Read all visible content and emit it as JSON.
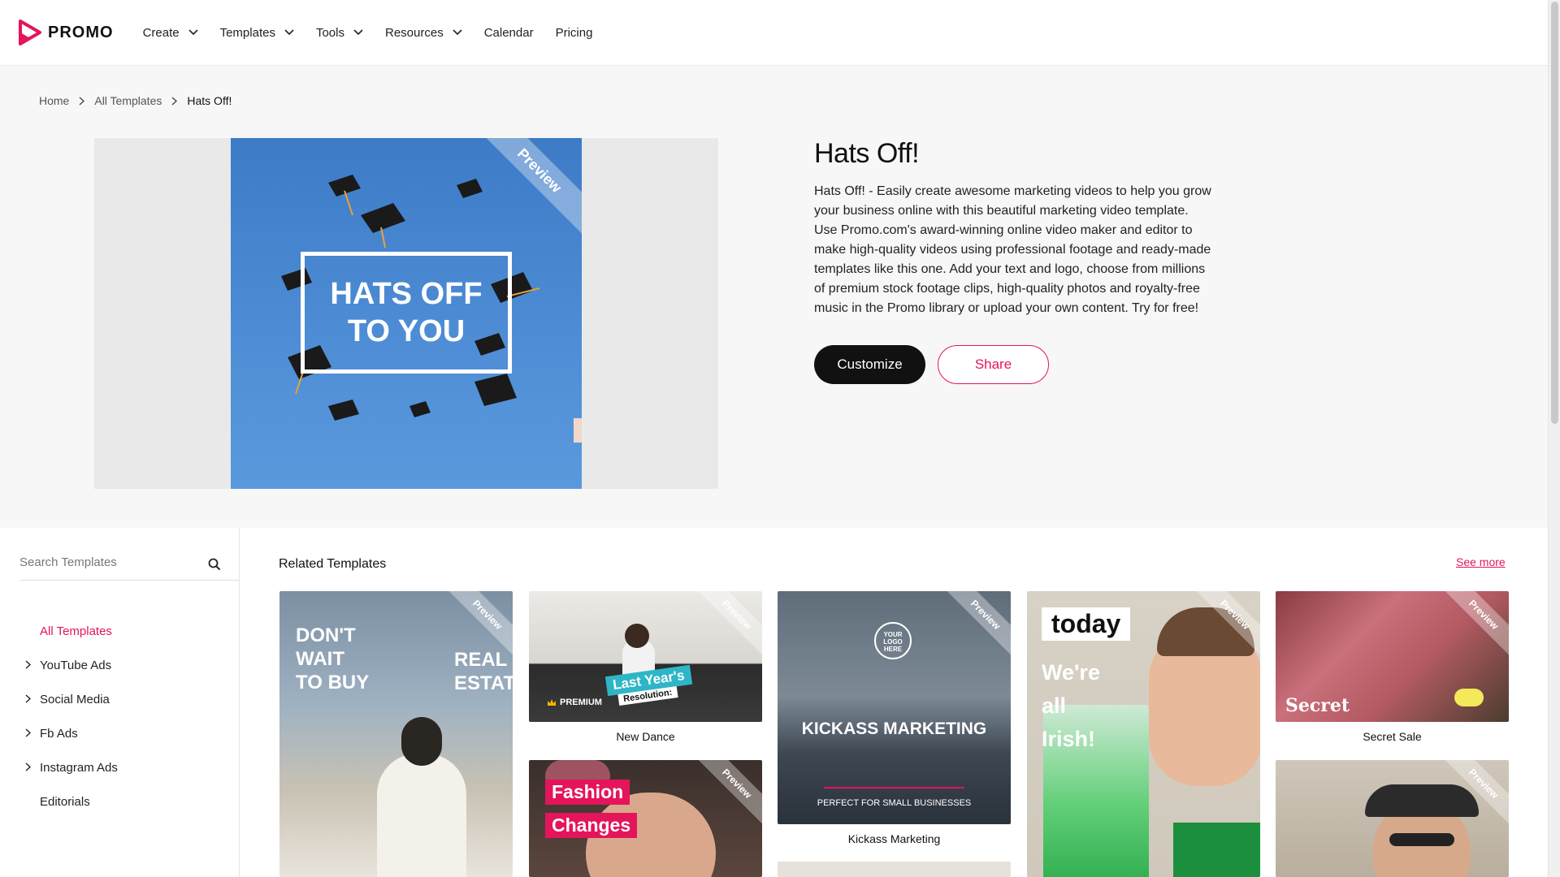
{
  "header": {
    "logo_text": "PROMO",
    "nav": [
      {
        "label": "Create",
        "has_dropdown": true
      },
      {
        "label": "Templates",
        "has_dropdown": true
      },
      {
        "label": "Tools",
        "has_dropdown": true
      },
      {
        "label": "Resources",
        "has_dropdown": true
      },
      {
        "label": "Calendar",
        "has_dropdown": false
      },
      {
        "label": "Pricing",
        "has_dropdown": false
      }
    ]
  },
  "breadcrumb": {
    "items": [
      "Home",
      "All Templates"
    ],
    "current": "Hats Off!"
  },
  "preview": {
    "ribbon": "Preview",
    "line1": "HATS OFF",
    "line2": "TO YOU"
  },
  "template": {
    "title": "Hats Off!",
    "description": "Hats Off! - Easily create awesome marketing videos to help you grow your business online with this beautiful marketing video template. Use Promo.com's award-winning online video maker and editor to make high-quality videos using professional footage and ready-made templates like this one. Add your text and logo, choose from millions of premium stock footage clips, high-quality photos and royalty-free music in the Promo library or upload your own content. Try for free!",
    "customize_label": "Customize",
    "share_label": "Share"
  },
  "sidebar": {
    "search_placeholder": "Search Templates",
    "categories": [
      {
        "label": "All Templates",
        "active": true,
        "expandable": false
      },
      {
        "label": "YouTube Ads",
        "active": false,
        "expandable": true
      },
      {
        "label": "Social Media",
        "active": false,
        "expandable": true
      },
      {
        "label": "Fb Ads",
        "active": false,
        "expandable": true
      },
      {
        "label": "Instagram Ads",
        "active": false,
        "expandable": true
      },
      {
        "label": "Editorials",
        "active": false,
        "expandable": false
      }
    ]
  },
  "related": {
    "title": "Related Templates",
    "see_more": "See more",
    "ribbon": "Preview",
    "premium_badge": "PREMIUM",
    "cards": [
      {
        "name": "",
        "overlay": [
          "DON'T",
          "WAIT",
          "TO BUY"
        ],
        "overlay2": [
          "REAL",
          "ESTATE"
        ]
      },
      {
        "name": "New Dance",
        "overlay": [
          "Last Year's",
          "Resolution:"
        ]
      },
      {
        "name": "Kickass Marketing",
        "overlay": [
          "KICKASS MARKETING"
        ],
        "sub": "PERFECT FOR SMALL BUSINESSES",
        "logo": [
          "YOUR",
          "LOGO",
          "HERE"
        ]
      },
      {
        "name": "",
        "overlay": [
          "today",
          "We're",
          "all",
          "Irish!"
        ]
      },
      {
        "name": "Secret Sale",
        "overlay": [
          "Secret"
        ]
      },
      {
        "name": "",
        "overlay": [
          "Fashion",
          "Changes"
        ]
      },
      {
        "name": "",
        "overlay": []
      }
    ]
  },
  "colors": {
    "accent": "#e4155a",
    "dark": "#111111",
    "preview_sky": "#4f8ed6"
  }
}
